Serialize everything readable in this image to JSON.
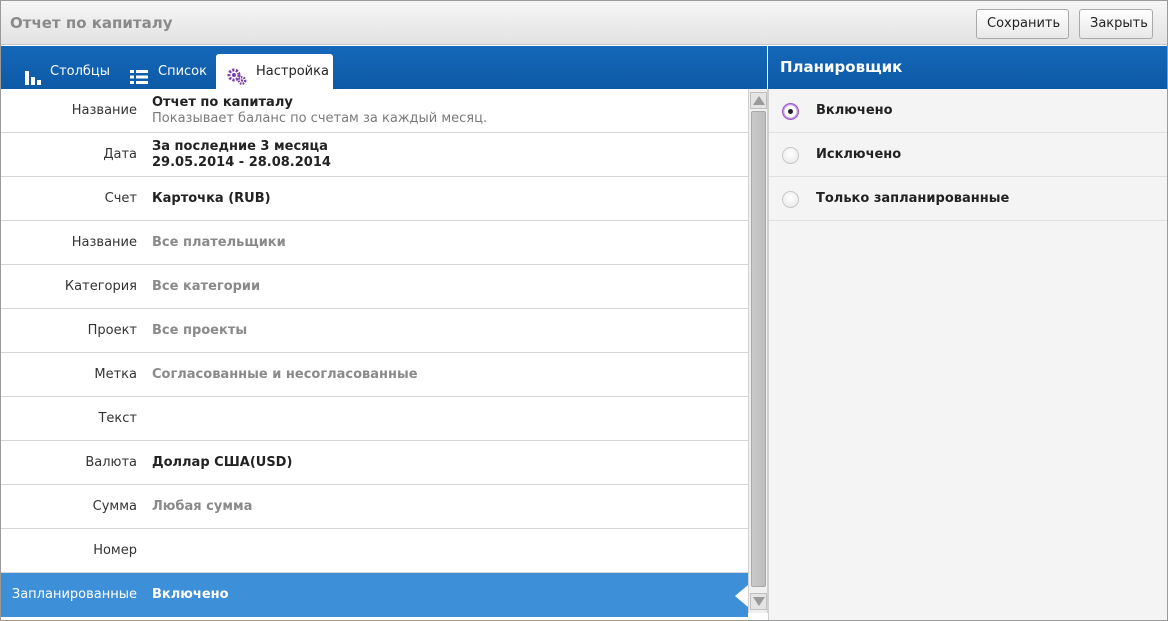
{
  "window": {
    "title": "Отчет по капиталу",
    "save_label": "Сохранить",
    "close_label": "Закрыть"
  },
  "tabs": [
    {
      "label": "Столбцы",
      "icon": "bar-chart-icon",
      "active": false
    },
    {
      "label": "Список",
      "icon": "list-icon",
      "active": false
    },
    {
      "label": "Настройка",
      "icon": "gears-icon",
      "active": true
    }
  ],
  "form": {
    "rows": [
      {
        "label": "Название",
        "value": "Отчет по капиталу",
        "sub": "Показывает баланс по счетам за каждый месяц."
      },
      {
        "label": "Дата",
        "value": "За последние 3 месяца",
        "value2": "29.05.2014 - 28.08.2014"
      },
      {
        "label": "Счет",
        "value": "Карточка (RUB)"
      },
      {
        "label": "Название",
        "value": "Все плательщики"
      },
      {
        "label": "Категория",
        "value": "Все категории"
      },
      {
        "label": "Проект",
        "value": "Все проекты"
      },
      {
        "label": "Метка",
        "value": "Согласованные и несогласованные"
      },
      {
        "label": "Текст",
        "value": ""
      },
      {
        "label": "Валюта",
        "value": "Доллар США(USD)"
      },
      {
        "label": "Сумма",
        "value": "Любая сумма"
      },
      {
        "label": "Номер",
        "value": ""
      },
      {
        "label": "Запланированные",
        "value": "Включено"
      }
    ]
  },
  "scheduler": {
    "title": "Планировщик",
    "options": [
      {
        "label": "Включено",
        "selected": true
      },
      {
        "label": "Исключено",
        "selected": false
      },
      {
        "label": "Только запланированные",
        "selected": false
      }
    ]
  },
  "colors": {
    "header_blue": "#1467b8",
    "selected_row": "#3d8fd8",
    "radio_accent": "#a86ad6"
  }
}
